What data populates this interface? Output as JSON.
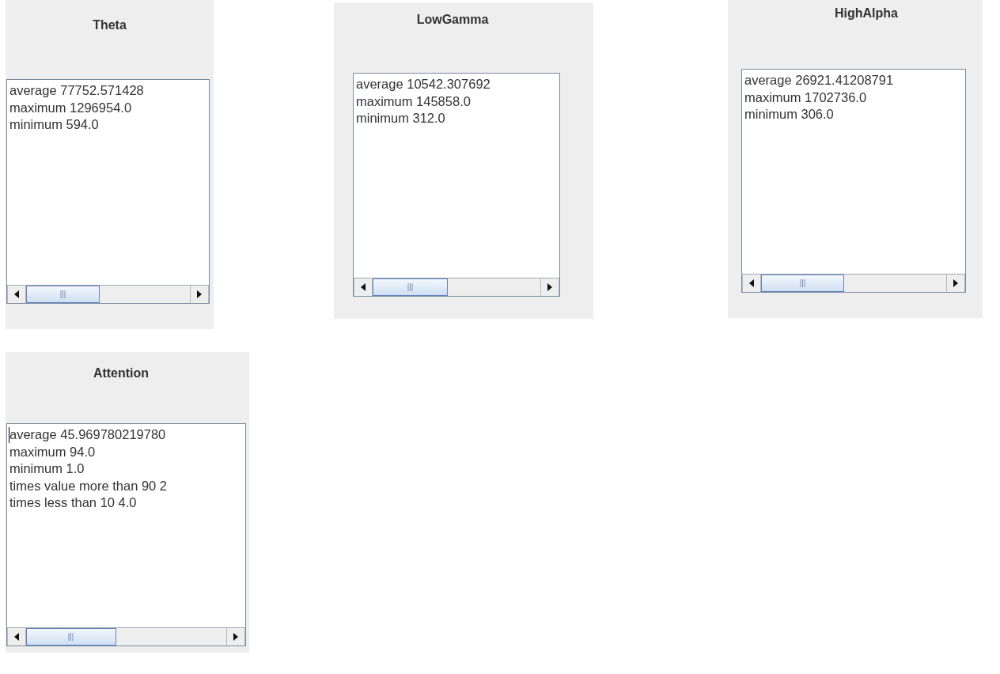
{
  "panels": [
    {
      "title": "Theta",
      "focused": false,
      "lines": [
        "average 77752.571428",
        "maximum 1296954.0",
        "minimum 594.0"
      ]
    },
    {
      "title": "LowGamma",
      "focused": false,
      "lines": [
        "average 10542.307692",
        "maximum 145858.0",
        "minimum 312.0"
      ]
    },
    {
      "title": "HighAlpha",
      "focused": false,
      "lines": [
        "average 26921.41208791",
        "maximum 1702736.0",
        "minimum 306.0"
      ]
    },
    {
      "title": "Attention",
      "focused": true,
      "lines": [
        "average 45.969780219780",
        "maximum 94.0",
        "minimum 1.0",
        "times value more than 90 2",
        "times less than 10 4.0"
      ]
    }
  ]
}
